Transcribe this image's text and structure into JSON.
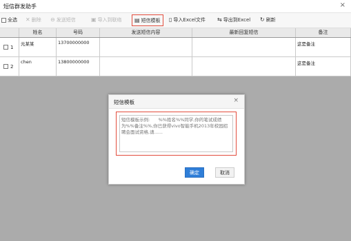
{
  "window": {
    "title": "短信群发助手",
    "close_glyph": "×"
  },
  "toolbar": {
    "select_all": "全选",
    "delete": "删除",
    "send_sms": "发送短信",
    "import_contacts": "导入到联络",
    "sms_template": "短信模板",
    "import_excel": "导入Excel文件",
    "export_excel": "导出到Excel",
    "refresh": "刷新"
  },
  "table": {
    "columns": [
      "姓名",
      "号码",
      "发送短信内容",
      "最新回复短信",
      "备注"
    ],
    "rows": [
      {
        "num": "1",
        "name": "元某某",
        "phone": "13700000000",
        "content": "",
        "reply": "",
        "note": "这是备注"
      },
      {
        "num": "2",
        "name": "chen",
        "phone": "13800000000",
        "content": "",
        "reply": "",
        "note": "这是备注"
      }
    ]
  },
  "modal": {
    "title": "短信模板",
    "close_glyph": "×",
    "placeholder": "短信模板示例:      %%姓名%%同学,你的笔试成绩为%%备注%%,你已获得vivo智能手机2013年校园招聘会面试资格,请......",
    "ok_label": "确定",
    "cancel_label": "取消"
  },
  "colors": {
    "highlight": "#e24b3b",
    "primary": "#2f7ed8",
    "grid_bg": "#ababab"
  }
}
